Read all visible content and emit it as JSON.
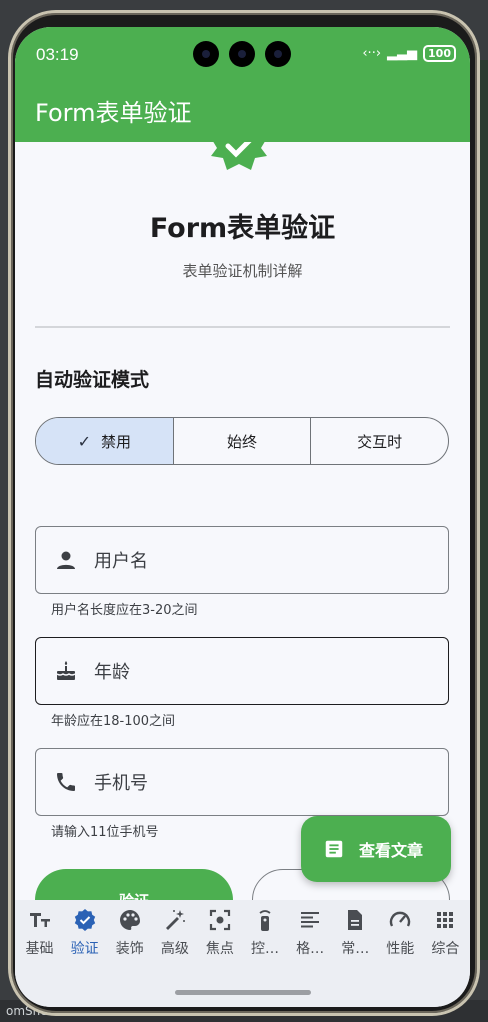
{
  "status": {
    "time": "03:19",
    "battery": "100"
  },
  "appbar": {
    "title": "Form表单验证"
  },
  "header": {
    "title": "Form表单验证",
    "subtitle": "表单验证机制详解"
  },
  "section": {
    "title": "自动验证模式"
  },
  "mode_selector": {
    "options": [
      "禁用",
      "始终",
      "交互时"
    ],
    "selected": "禁用"
  },
  "fields": [
    {
      "icon": "person-icon",
      "label": "用户名",
      "helper": "用户名长度应在3-20之间"
    },
    {
      "icon": "cake-icon",
      "label": "年龄",
      "helper": "年龄应在18-100之间"
    },
    {
      "icon": "phone-icon",
      "label": "手机号",
      "helper": "请输入11位手机号"
    }
  ],
  "buttons": {
    "verify": "验证"
  },
  "fab": {
    "label": "查看文章"
  },
  "nav": {
    "active": "验证",
    "items": [
      "基础",
      "验证",
      "装饰",
      "高级",
      "焦点",
      "控…",
      "格…",
      "常…",
      "性能",
      "综合"
    ]
  },
  "colors": {
    "primary": "#4caf50",
    "selected_segment": "#d6e3f7",
    "nav_active": "#2b62b5"
  },
  "desktop": {
    "bottom_text": "omShe"
  }
}
